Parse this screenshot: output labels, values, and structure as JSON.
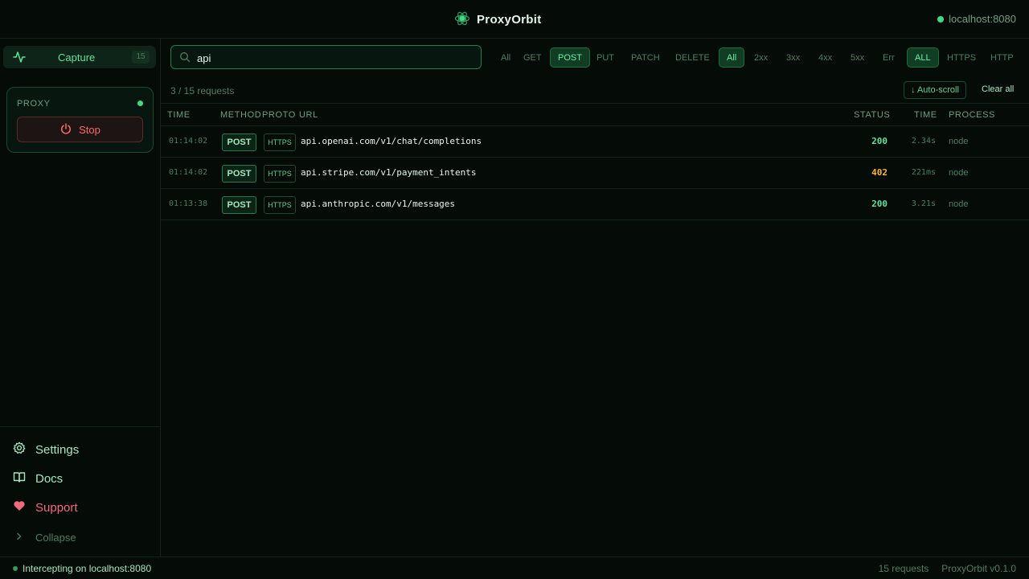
{
  "app": {
    "name": "ProxyOrbit",
    "host": "localhost:8080"
  },
  "sidebar": {
    "capture_label": "Capture",
    "capture_count": "15",
    "proxy_title": "PROXY",
    "stop_label": "Stop",
    "settings_label": "Settings",
    "docs_label": "Docs",
    "support_label": "Support",
    "collapse_label": "Collapse"
  },
  "filters": {
    "search_value": "api",
    "methods": [
      {
        "label": "All",
        "active": false
      },
      {
        "label": "GET",
        "active": false
      },
      {
        "label": "POST",
        "active": true
      },
      {
        "label": "PUT",
        "active": false
      },
      {
        "label": "PATCH",
        "active": false
      },
      {
        "label": "DELETE",
        "active": false
      }
    ],
    "statuses": [
      {
        "label": "All",
        "active": true
      },
      {
        "label": "2xx",
        "active": false
      },
      {
        "label": "3xx",
        "active": false
      },
      {
        "label": "4xx",
        "active": false
      },
      {
        "label": "5xx",
        "active": false
      },
      {
        "label": "Err",
        "active": false
      }
    ],
    "protocols": [
      {
        "label": "ALL",
        "active": true
      },
      {
        "label": "HTTPS",
        "active": false
      },
      {
        "label": "HTTP",
        "active": false
      }
    ]
  },
  "toolbar": {
    "request_count": "3 / 15 requests",
    "autoscroll_label": "↓ Auto-scroll",
    "clear_label": "Clear all"
  },
  "table": {
    "headers": {
      "time": "TIME",
      "method": "METHOD",
      "proto": "PROTO",
      "url": "URL",
      "status": "STATUS",
      "duration": "TIME",
      "process": "PROCESS"
    },
    "rows": [
      {
        "time": "01:14:02",
        "method": "POST",
        "proto": "HTTPS",
        "url": "api.openai.com/v1/chat/completions",
        "status": "200",
        "duration": "2.34s",
        "process": "node"
      },
      {
        "time": "01:14:02",
        "method": "POST",
        "proto": "HTTPS",
        "url": "api.stripe.com/v1/payment_intents",
        "status": "402",
        "duration": "221ms",
        "process": "node"
      },
      {
        "time": "01:13:38",
        "method": "POST",
        "proto": "HTTPS",
        "url": "api.anthropic.com/v1/messages",
        "status": "200",
        "duration": "3.21s",
        "process": "node"
      }
    ]
  },
  "statusbar": {
    "intercepting": "Intercepting on localhost:8080",
    "total": "15 requests",
    "version": "ProxyOrbit v0.1.0"
  },
  "colors": {
    "accent": "#3ddc84",
    "status_ok": "#5fe39a",
    "status_warn": "#f5b93a",
    "danger": "#ff6b6b"
  }
}
